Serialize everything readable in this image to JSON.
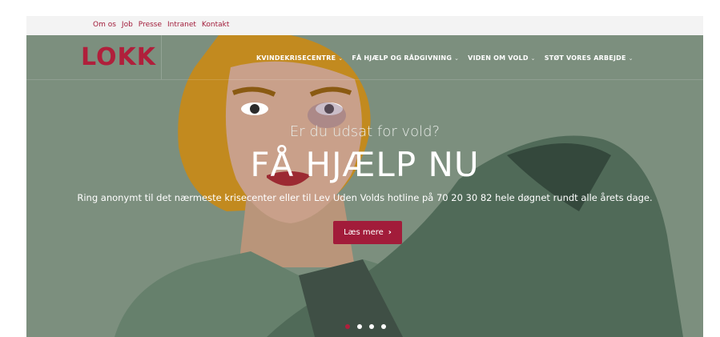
{
  "topbar": {
    "links": [
      "Om os",
      "Job",
      "Presse",
      "Intranet",
      "Kontakt"
    ]
  },
  "brand": {
    "logo": "LOKK",
    "color": "#b01f3b"
  },
  "nav": {
    "items": [
      {
        "label": "KVINDEKRISECENTRE"
      },
      {
        "label": "FÅ HJÆLP OG RÅDGIVNING"
      },
      {
        "label": "VIDEN OM VOLD"
      },
      {
        "label": "STØT VORES ARBEJDE"
      }
    ],
    "chevron": "⌄"
  },
  "hero": {
    "subtitle": "Er du udsat for vold?",
    "headline": "FÅ HJÆLP NU",
    "description": "Ring anonymt til det nærmeste krisecenter eller til Lev Uden Volds hotline på 70 20 30 82 hele døgnet rundt alle årets dage.",
    "cta_label": "Læs mere",
    "cta_icon": "›",
    "slides_count": 4,
    "active_slide": 1
  },
  "colors": {
    "hero_bg": "#7c8f7e",
    "accent": "#a21c3a",
    "topbar_bg": "#f3f3f3"
  }
}
